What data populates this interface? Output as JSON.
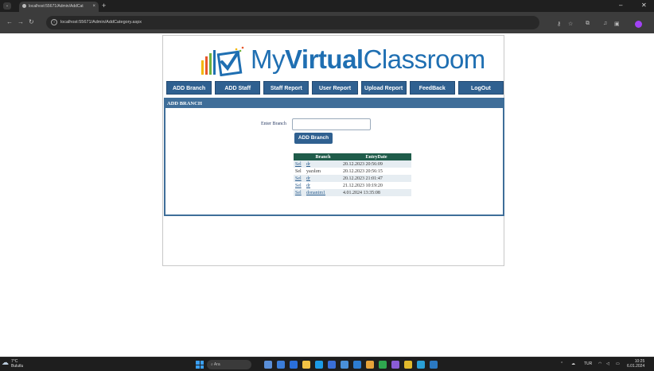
{
  "browser": {
    "tab_title": "localhost:55671/Admin/AddCat",
    "tab_close": "×",
    "new_tab": "+",
    "url": "localhost:55671/Admin/AddCategory.aspx",
    "minimize": "–",
    "close": "✕"
  },
  "site": {
    "title_part1": "My",
    "title_part2": "Virtual",
    "title_part3": "Classroom"
  },
  "menu": [
    "ADD Branch",
    "ADD Staff",
    "Staff Report",
    "User Report",
    "Upload Report",
    "FeedBack",
    "LogOut"
  ],
  "panel": {
    "heading": "ADD BRANCH",
    "input_label": "Enter Branch",
    "input_value": "",
    "submit_label": "ADD Branch"
  },
  "table": {
    "headers": [
      "",
      "Branch",
      "EntryDate"
    ],
    "rows": [
      {
        "select": "Sel",
        "branch": "dr",
        "date": "20.12.2023 20:56:09"
      },
      {
        "select": "Sel",
        "branch": "yazılım",
        "date": "20.12.2023 20:56:15"
      },
      {
        "select": "Sel",
        "branch": "dr",
        "date": "20.12.2023 21:01:47"
      },
      {
        "select": "Sel",
        "branch": "dr",
        "date": "21.12.2023 10:19:20"
      },
      {
        "select": "Sel",
        "branch": "donanim1",
        "date": "4.01.2024 13:35:08"
      }
    ]
  },
  "taskbar": {
    "weather_temp": "7°C",
    "weather_desc": "Bulutlu",
    "search_placeholder": "Ara",
    "lang": "TUR",
    "time": "10:25",
    "date": "6.01.2024"
  },
  "colors": {
    "brand_blue": "#1f6fb2",
    "menu_blue": "#2f6090",
    "panel_blue": "#3f6e99",
    "table_header_green": "#1f5c4a"
  }
}
